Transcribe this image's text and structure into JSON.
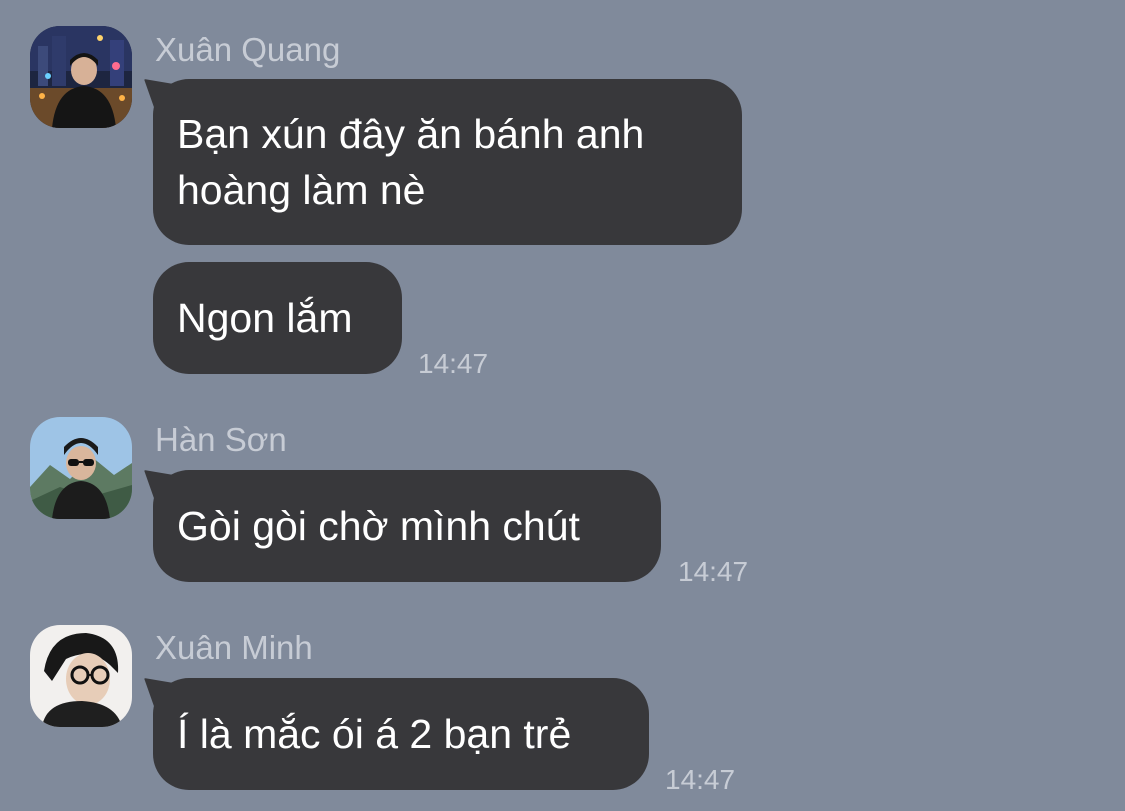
{
  "colors": {
    "background": "#808a9b",
    "bubble": "#38383b",
    "bubble_text": "#ffffff",
    "meta_text": "#c7ccd5"
  },
  "messages": [
    {
      "sender": "Xuân Quang",
      "avatar_icon": "avatar-photo-city-night",
      "bubbles": [
        {
          "lines": [
            "Bạn xún đây ăn bánh anh",
            "hoàng làm nè"
          ]
        },
        {
          "lines": [
            "Ngon lắm"
          ],
          "time": "14:47"
        }
      ]
    },
    {
      "sender": "Hàn Sơn",
      "avatar_icon": "avatar-photo-mountain-sunglasses",
      "bubbles": [
        {
          "lines": [
            "Gòi gòi chờ mình chút"
          ],
          "time": "14:47"
        }
      ]
    },
    {
      "sender": "Xuân Minh",
      "avatar_icon": "avatar-photo-glasses-portrait",
      "bubbles": [
        {
          "lines": [
            "Í là mắc ói á 2 bạn trẻ"
          ],
          "time": "14:47"
        }
      ]
    }
  ]
}
